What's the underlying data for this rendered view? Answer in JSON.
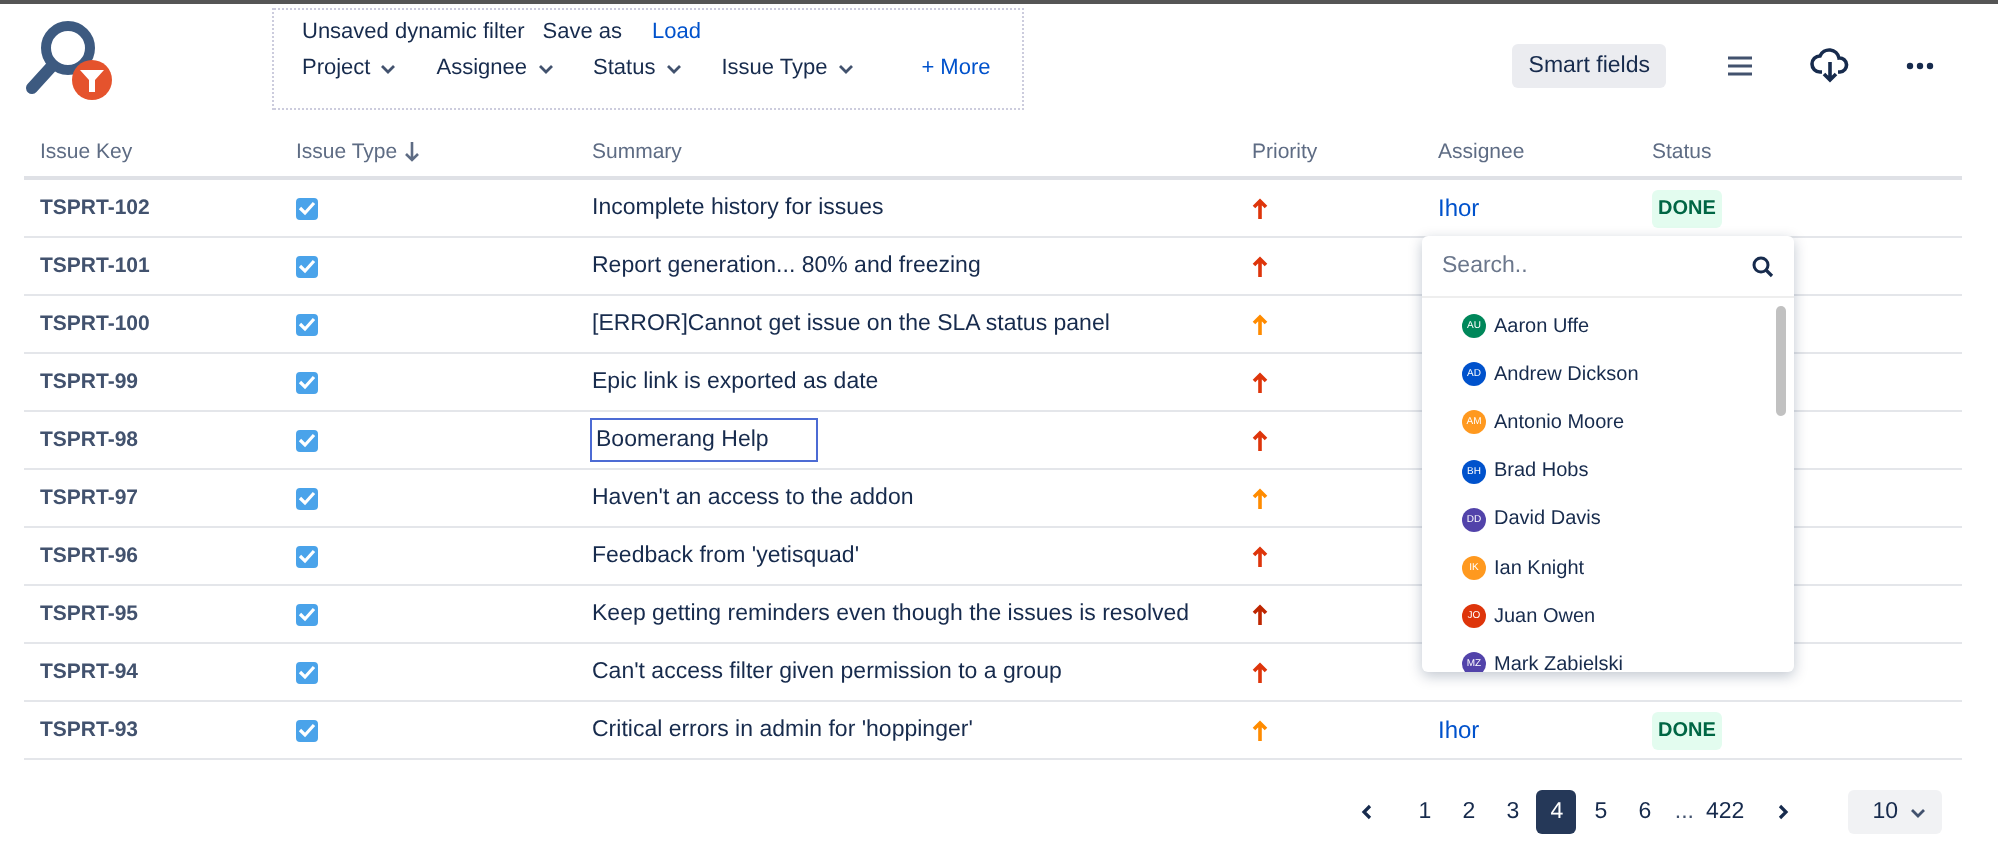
{
  "filter": {
    "title": "Unsaved dynamic filter",
    "save_as": "Save as",
    "load": "Load",
    "dropdowns": [
      "Project",
      "Assignee",
      "Status",
      "Issue Type"
    ],
    "more": "+ More"
  },
  "toolbar": {
    "smart_fields": "Smart fields"
  },
  "table": {
    "columns": [
      {
        "label": "Issue Key",
        "sorted": false
      },
      {
        "label": "Issue Type",
        "sorted": true
      },
      {
        "label": "Summary",
        "sorted": false
      },
      {
        "label": "Priority",
        "sorted": false
      },
      {
        "label": "Assignee",
        "sorted": false
      },
      {
        "label": "Status",
        "sorted": false
      }
    ],
    "rows": [
      {
        "key": "TSPRT-102",
        "checked": true,
        "summary": "Incomplete history for issues",
        "editing": false,
        "priority": {
          "color": "#de350b"
        },
        "assignee": "Ihor",
        "status": "DONE"
      },
      {
        "key": "TSPRT-101",
        "checked": true,
        "summary": "Report generation... 80% and freezing",
        "editing": false,
        "priority": {
          "color": "#de350b"
        }
      },
      {
        "key": "TSPRT-100",
        "checked": true,
        "summary": "[ERROR]Cannot get issue on the SLA status panel",
        "editing": false,
        "priority": {
          "color": "#ff8b00"
        }
      },
      {
        "key": "TSPRT-99",
        "checked": true,
        "summary": "Epic link is exported as date",
        "editing": false,
        "priority": {
          "color": "#de350b"
        }
      },
      {
        "key": "TSPRT-98",
        "checked": true,
        "summary": "Boomerang Help",
        "editing": true,
        "priority": {
          "color": "#de350b"
        }
      },
      {
        "key": "TSPRT-97",
        "checked": true,
        "summary": "Haven't an access to the addon",
        "editing": false,
        "priority": {
          "color": "#ff8b00"
        }
      },
      {
        "key": "TSPRT-96",
        "checked": true,
        "summary": "Feedback from 'yetisquad'",
        "editing": false,
        "priority": {
          "color": "#de350b"
        }
      },
      {
        "key": "TSPRT-95",
        "checked": true,
        "summary": "Keep getting reminders even though the issues is resolved",
        "editing": false,
        "priority": {
          "color": "#bf2600"
        }
      },
      {
        "key": "TSPRT-94",
        "checked": true,
        "summary": "Can't access filter given permission to a group",
        "editing": false,
        "priority": {
          "color": "#de350b"
        }
      },
      {
        "key": "TSPRT-93",
        "checked": true,
        "summary": "Critical errors in admin for 'hoppinger'",
        "editing": false,
        "priority": {
          "color": "#ff8b00"
        },
        "assignee": "Ihor",
        "status": "DONE"
      }
    ]
  },
  "assignee_dropdown": {
    "placeholder": "Search..",
    "users": [
      {
        "initials": "AU",
        "name": "Aaron Uffe",
        "color": "#00875a"
      },
      {
        "initials": "AD",
        "name": "Andrew Dickson",
        "color": "#0052cc"
      },
      {
        "initials": "AM",
        "name": "Antonio Moore",
        "color": "#ff991f"
      },
      {
        "initials": "BH",
        "name": "Brad Hobs",
        "color": "#0052cc"
      },
      {
        "initials": "DD",
        "name": "David Davis",
        "color": "#5243aa"
      },
      {
        "initials": "IK",
        "name": "Ian Knight",
        "color": "#ff991f"
      },
      {
        "initials": "JO",
        "name": "Juan Owen",
        "color": "#de350b"
      },
      {
        "initials": "MZ",
        "name": "Mark Zabielski",
        "color": "#5243aa"
      }
    ]
  },
  "pagination": {
    "pages": [
      {
        "label": "1",
        "selected": false
      },
      {
        "label": "2",
        "selected": false
      },
      {
        "label": "3",
        "selected": false
      },
      {
        "label": "4",
        "selected": true
      },
      {
        "label": "5",
        "selected": false
      },
      {
        "label": "6",
        "selected": false
      }
    ],
    "ellipsis": "...",
    "last": "422",
    "page_size": "10"
  }
}
